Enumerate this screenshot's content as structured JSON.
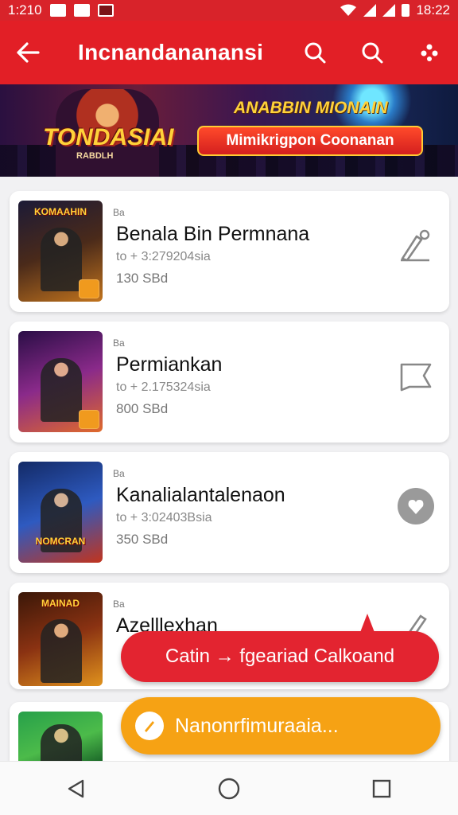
{
  "status_bar": {
    "time": "1:210",
    "clock": "18:22"
  },
  "app_bar": {
    "title": "Incnandananansi",
    "icons": [
      "back-arrow-icon",
      "search-icon",
      "search-icon",
      "more-icon"
    ]
  },
  "banner": {
    "logo_text": "TONDASIAI",
    "logo_sub": "RABDLH",
    "headline": "ANABBIN MIONAIN",
    "pill_text": "Mimikrigpon Coonanan"
  },
  "games": [
    {
      "category": "Ba",
      "name": "Benala Bin Permnana",
      "meta": "to + 3:279204sia",
      "size": "130 SBd",
      "art_title": "KOMAAHIN",
      "action_icon": "edit-icon"
    },
    {
      "category": "Ba",
      "name": "Permiankan",
      "meta": "to + 2.175324sia",
      "size": "800 SBd",
      "art_title": "",
      "action_icon": "bookmark-icon"
    },
    {
      "category": "Ba",
      "name": "Kanalialantalenaon",
      "meta": "to + 3:02403Bsia",
      "size": "350 SBd",
      "art_title": "NOMCRAN",
      "action_icon": "heart-bubble-icon"
    },
    {
      "category": "Ba",
      "name": "Azelllexhan",
      "meta": "",
      "size": "",
      "art_title": "MAINAD",
      "action_icon": "edit-icon"
    }
  ],
  "fab_red": {
    "label": "Catin → fgeariad Calkoand"
  },
  "fab_orange": {
    "label": "Nanonrfimuraaia..."
  },
  "colors": {
    "brand_red": "#e21f26",
    "accent_orange": "#f6a214"
  }
}
